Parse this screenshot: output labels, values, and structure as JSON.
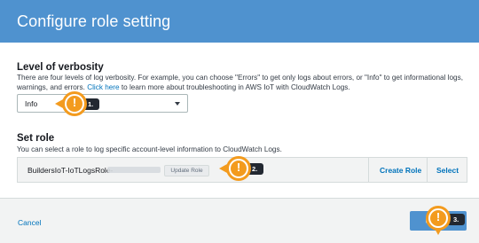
{
  "header": {
    "title": "Configure role setting"
  },
  "verbosity": {
    "title": "Level of verbosity",
    "desc_before": "There are four levels of log verbosity. For example, you can choose \"Errors\" to get only logs about errors, or \"Info\" to get informational logs, warnings, and errors.",
    "link": "Click here",
    "desc_after": "to learn more about troubleshooting in AWS IoT with CloudWatch Logs.",
    "selected": "Info"
  },
  "role": {
    "title": "Set role",
    "desc": "You can select a role to log specific account-level information to CloudWatch Logs.",
    "name": "BuildersIoT-IoTLogsRole-",
    "update_role": "Update Role",
    "create_role": "Create Role",
    "select": "Select"
  },
  "footer": {
    "cancel": "Cancel",
    "update": "Update"
  },
  "callouts": {
    "c1": "1.",
    "c2": "2.",
    "c3": "3.",
    "glyph": "!"
  },
  "colors": {
    "header": "#4f92cf",
    "link": "#0073bb",
    "callout": "#f39b1e",
    "tag": "#222831"
  }
}
